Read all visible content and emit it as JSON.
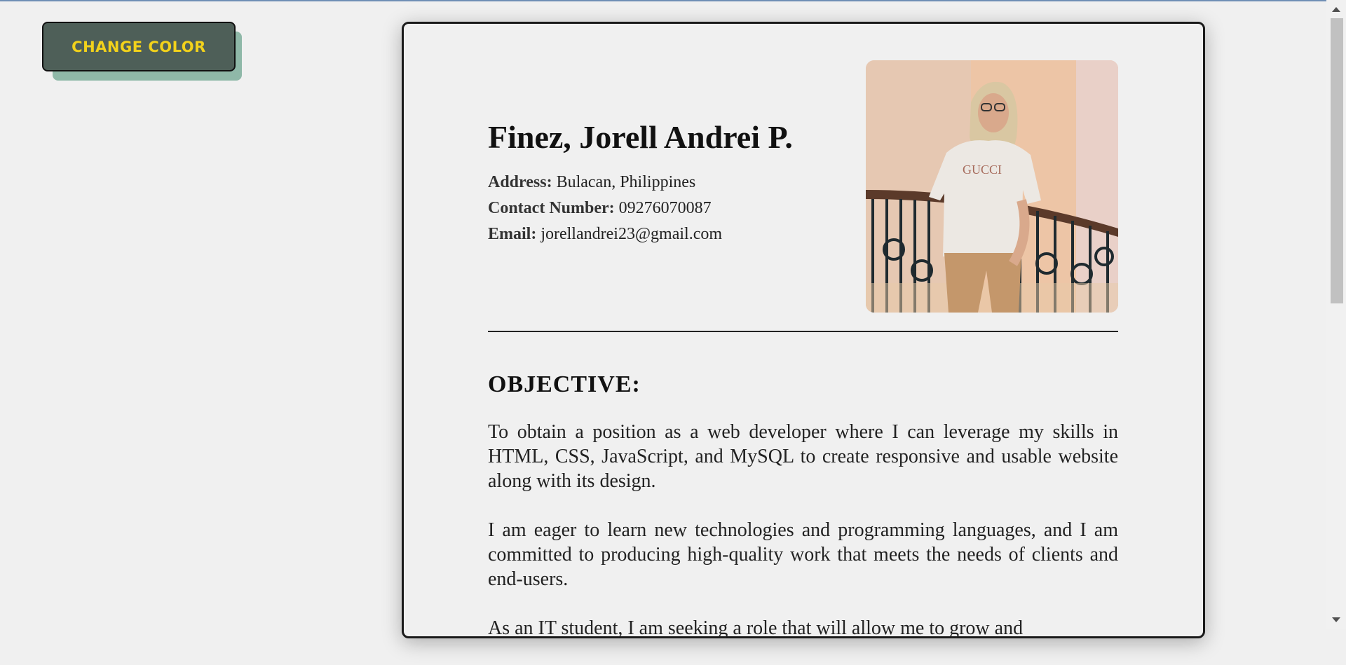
{
  "toolbar": {
    "change_color_label": "CHANGE COLOR"
  },
  "profile": {
    "name": "Finez, Jorell Andrei P.",
    "address_label": "Address:",
    "address": "Bulacan, Philippines",
    "contact_label": "Contact Number:",
    "contact": "09276070087",
    "email_label": "Email:",
    "email": "jorellandrei23@gmail.com",
    "photo_shirt_text": "GUCCI"
  },
  "objective": {
    "title": "OBJECTIVE:",
    "paragraphs": [
      "To obtain a position as a web developer where I can leverage my skills in HTML, CSS, JavaScript, and MySQL to create responsive and usable website along with its design.",
      "I am eager to learn new technologies and programming languages, and I am committed to producing high-quality work that meets the needs of clients and end-users.",
      "As an IT student, I am seeking a role that will allow me to grow and"
    ]
  },
  "colors": {
    "button_bg": "#4e5f58",
    "button_text": "#f2d21b",
    "button_shadow": "#8fb8a8"
  }
}
